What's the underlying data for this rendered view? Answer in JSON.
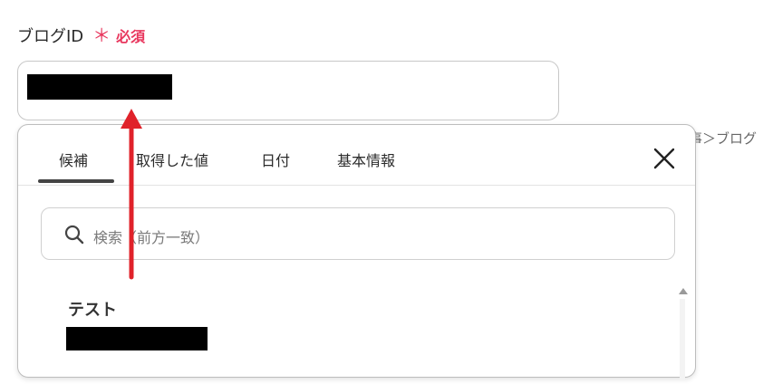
{
  "field": {
    "label": "ブログID",
    "required_star": "＊",
    "required_text": "必須"
  },
  "background_hint": "事＞ブログ",
  "popover": {
    "tabs": [
      {
        "label": "候補",
        "active": true
      },
      {
        "label": "取得した値",
        "active": false
      },
      {
        "label": "日付",
        "active": false
      },
      {
        "label": "基本情報",
        "active": false
      }
    ],
    "close_icon": "close-icon",
    "search": {
      "icon": "search-icon",
      "placeholder": "検索（前方一致）"
    },
    "items": [
      {
        "title": "テスト"
      }
    ]
  },
  "colors": {
    "required": "#e8365d",
    "arrow": "#e0222a"
  }
}
